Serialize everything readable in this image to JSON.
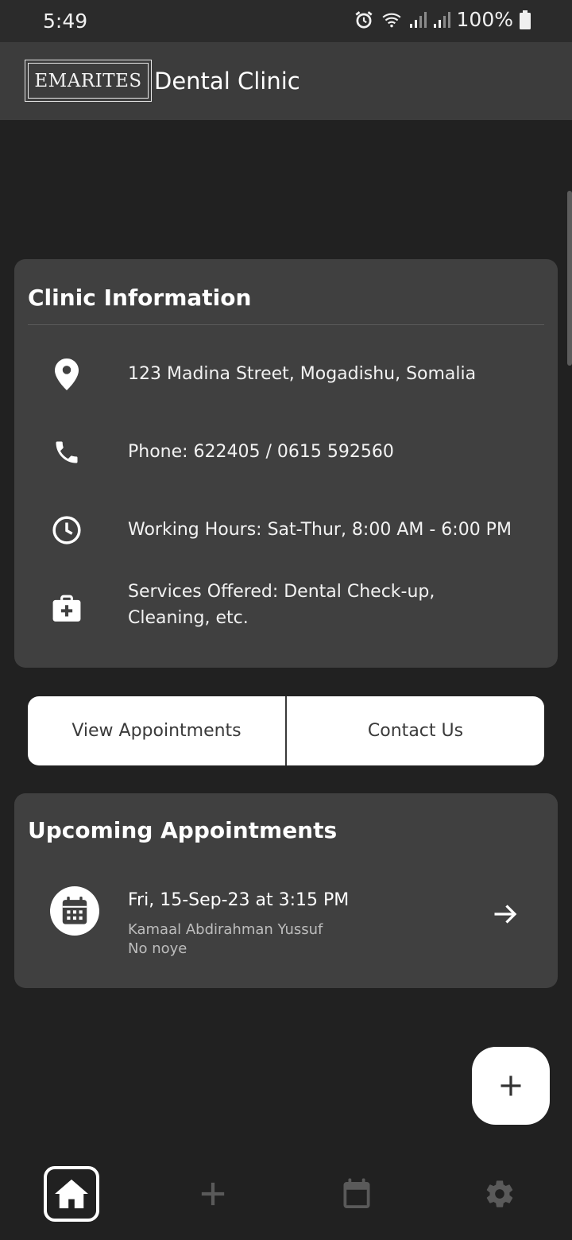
{
  "status_bar": {
    "time": "5:49",
    "battery": "100%",
    "icons": [
      "alarm-icon",
      "wifi-icon",
      "signal-icon",
      "signal-icon",
      "battery-icon"
    ]
  },
  "app_bar": {
    "logo_text": "EMARITES",
    "title": "Dental Clinic"
  },
  "clinic_info": {
    "title": "Clinic Information",
    "rows": [
      {
        "icon": "location-pin-icon",
        "text": "123 Madina Street, Mogadishu, Somalia"
      },
      {
        "icon": "phone-icon",
        "text": "Phone: 622405 / 0615 592560"
      },
      {
        "icon": "clock-icon",
        "text": "Working Hours: Sat-Thur, 8:00 AM - 6:00 PM"
      },
      {
        "icon": "medical-bag-icon",
        "text": "Services Offered: Dental Check-up, Cleaning, etc."
      }
    ]
  },
  "actions": {
    "view_appointments": "View Appointments",
    "contact_us": "Contact Us"
  },
  "upcoming": {
    "title": "Upcoming Appointments",
    "appointments": [
      {
        "date": "Fri, 15-Sep-23 at 3:15 PM",
        "name": "Kamaal Abdirahman Yussuf",
        "note": "No noye"
      }
    ]
  },
  "fab": {
    "icon": "plus-icon"
  },
  "bottom_nav": {
    "items": [
      {
        "icon": "home-icon",
        "active": true
      },
      {
        "icon": "plus-icon",
        "active": false
      },
      {
        "icon": "calendar-icon",
        "active": false
      },
      {
        "icon": "gear-icon",
        "active": false
      }
    ]
  },
  "colors": {
    "background": "#212121",
    "card": "#404040",
    "app_bar": "#3c3c3c",
    "inactive_nav": "#5a5a5a"
  }
}
